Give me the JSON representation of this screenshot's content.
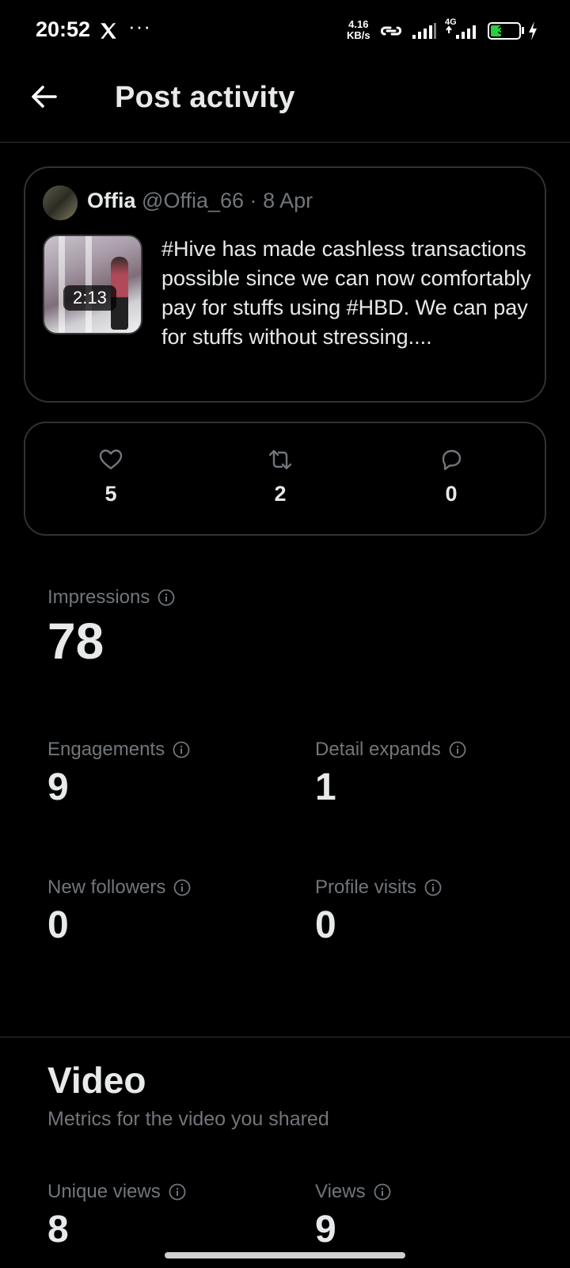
{
  "status_bar": {
    "time": "20:52",
    "more": "···",
    "speed_value": "4.16",
    "speed_unit": "KB/s",
    "network": "4G",
    "battery": "39",
    "battery_level": 0.39
  },
  "header": {
    "title": "Post activity"
  },
  "tweet": {
    "author_name": "Offia",
    "author_handle": "@Offia_66",
    "separator": "·",
    "date": "8 Apr",
    "video_duration": "2:13",
    "text": "#Hive has made cashless transactions possible since we can now comfortably pay for stuffs using #HBD. We can pay for stuffs without stressing...."
  },
  "engagement": {
    "likes": "5",
    "reposts": "2",
    "replies": "0"
  },
  "metrics": {
    "impressions": {
      "label": "Impressions",
      "value": "78"
    },
    "engagements": {
      "label": "Engagements",
      "value": "9"
    },
    "detail_expands": {
      "label": "Detail expands",
      "value": "1"
    },
    "new_followers": {
      "label": "New followers",
      "value": "0"
    },
    "profile_visits": {
      "label": "Profile visits",
      "value": "0"
    }
  },
  "video_section": {
    "title": "Video",
    "subtitle": "Metrics for the video you shared",
    "unique_views": {
      "label": "Unique views",
      "value": "8"
    },
    "views": {
      "label": "Views",
      "value": "9"
    }
  },
  "colors": {
    "background": "#000000",
    "primary_text": "#e7e9ea",
    "secondary_text": "#71767b",
    "border": "#2f3336",
    "battery": "#2ecc40"
  }
}
